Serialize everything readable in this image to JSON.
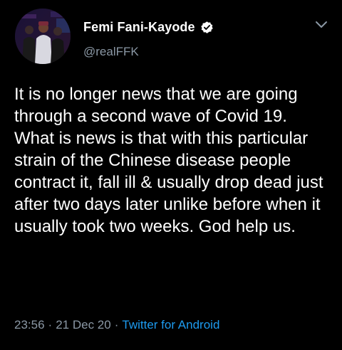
{
  "user": {
    "display_name": "Femi Fani-Kayode",
    "handle": "@realFFK",
    "verified": true
  },
  "icons": {
    "verified": "verified-badge-icon",
    "menu": "chevron-down-icon"
  },
  "tweet": {
    "text": "It is no longer news that we are going through a second wave of Covid 19. What is news is that with this particular strain of the Chinese disease people contract it, fall ill & usually drop dead just after two days later unlike before when it usually took two weeks. God help us.",
    "time": "23:56",
    "separator": "·",
    "date": "21 Dec 20",
    "source": "Twitter for Android"
  },
  "colors": {
    "background": "#000000",
    "text": "#ffffff",
    "secondary": "#8b98a5",
    "link": "#1d9bf0"
  }
}
